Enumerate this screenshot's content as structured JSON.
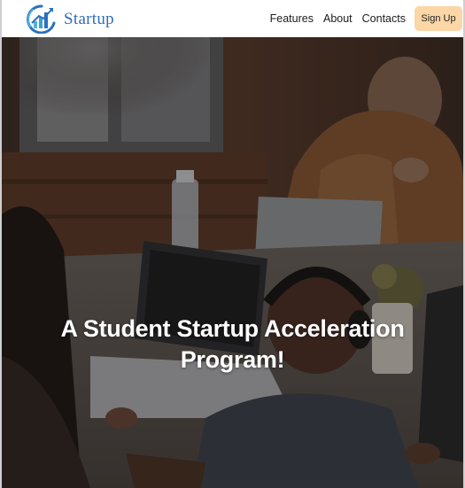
{
  "brand": {
    "name": "Startup",
    "logo_icon": "growth-chart-logo-icon",
    "colors": {
      "text": "#2f6db5",
      "bars": "#3aa0d8",
      "arrow": "#2a6fc0"
    }
  },
  "nav": {
    "links": [
      {
        "label": "Features"
      },
      {
        "label": "About"
      },
      {
        "label": "Contacts"
      }
    ],
    "signup_label": "Sign Up",
    "signup_color": "#fbd6a6"
  },
  "hero": {
    "title_line1": "A Student Startup Acceleration",
    "title_line2": "Program!",
    "background": "photo-students-working-on-laptops"
  }
}
